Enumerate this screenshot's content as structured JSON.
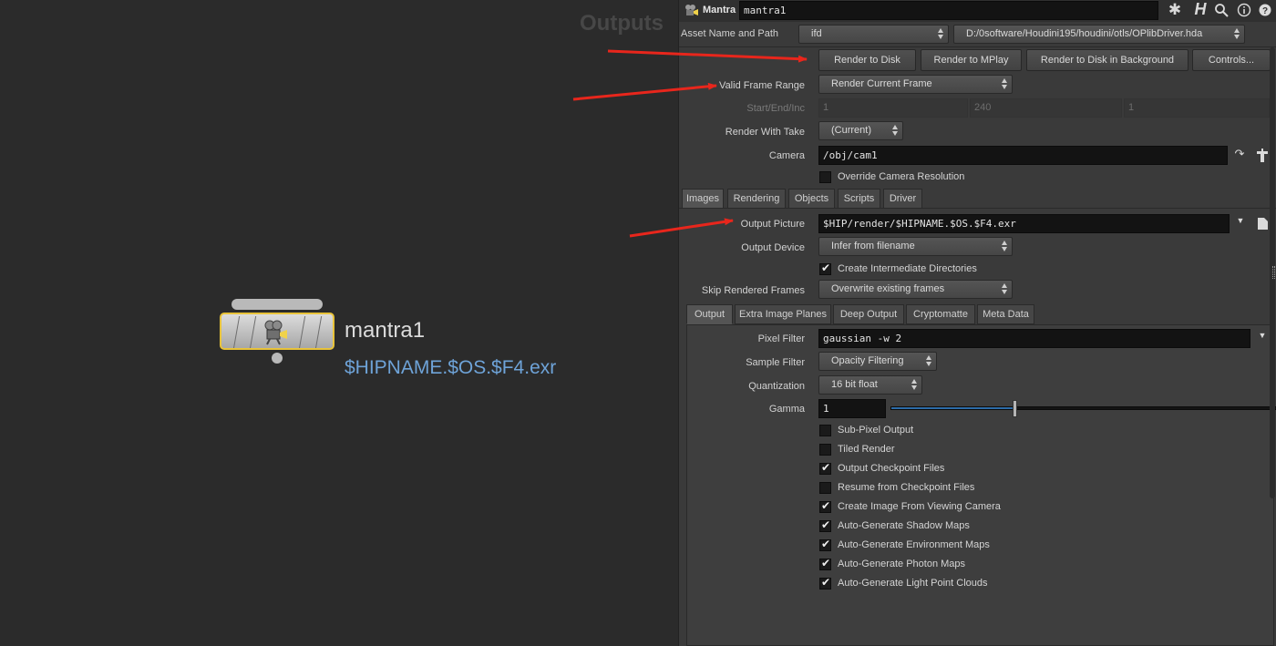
{
  "network": {
    "title": "Outputs",
    "node": {
      "name": "mantra1",
      "output_label": "$HIPNAME.$OS.$F4.exr"
    }
  },
  "header": {
    "type_label": "Mantra",
    "node_name_value": "mantra1",
    "icons": [
      "gear-icon",
      "houdini-help-icon",
      "search-icon",
      "info-icon",
      "help-icon"
    ]
  },
  "asset": {
    "label": "Asset Name and Path",
    "name_value": "ifd",
    "path_value": "D:/0software/Houdini195/houdini/otls/OPlibDriver.hda"
  },
  "render_buttons": [
    "Render to Disk",
    "Render to MPlay",
    "Render to Disk in Background",
    "Controls..."
  ],
  "params": {
    "valid_frame_range": {
      "label": "Valid Frame Range",
      "value": "Render Current Frame"
    },
    "start_end_inc": {
      "label": "Start/End/Inc",
      "values": [
        "1",
        "240",
        "1"
      ]
    },
    "render_with_take": {
      "label": "Render With Take",
      "value": "(Current)"
    },
    "camera": {
      "label": "Camera",
      "value": "/obj/cam1"
    },
    "override_cam_res": {
      "label": "Override Camera Resolution",
      "checked": false
    }
  },
  "main_tabs": [
    "Images",
    "Rendering",
    "Objects",
    "Scripts",
    "Driver"
  ],
  "images": {
    "output_picture": {
      "label": "Output Picture",
      "value": "$HIP/render/$HIPNAME.$OS.$F4.exr"
    },
    "output_device": {
      "label": "Output Device",
      "value": "Infer from filename"
    },
    "create_dirs": {
      "label": "Create Intermediate Directories",
      "checked": true
    },
    "skip_frames": {
      "label": "Skip Rendered Frames",
      "value": "Overwrite existing frames"
    }
  },
  "sub_tabs": [
    "Output",
    "Extra Image Planes",
    "Deep Output",
    "Cryptomatte",
    "Meta Data"
  ],
  "output": {
    "pixel_filter": {
      "label": "Pixel Filter",
      "value": "gaussian -w 2"
    },
    "sample_filter": {
      "label": "Sample Filter",
      "value": "Opacity Filtering"
    },
    "quantization": {
      "label": "Quantization",
      "value": "16 bit float"
    },
    "gamma": {
      "label": "Gamma",
      "value": "1",
      "slider_fraction": 0.32
    },
    "checkboxes": [
      {
        "label": "Sub-Pixel Output",
        "checked": false
      },
      {
        "label": "Tiled Render",
        "checked": false
      },
      {
        "label": "Output Checkpoint Files",
        "checked": true
      },
      {
        "label": "Resume from Checkpoint Files",
        "checked": false
      },
      {
        "label": "Create Image From Viewing Camera",
        "checked": true
      },
      {
        "label": "Auto-Generate Shadow Maps",
        "checked": true
      },
      {
        "label": "Auto-Generate Environment Maps",
        "checked": true
      },
      {
        "label": "Auto-Generate Photon Maps",
        "checked": true
      },
      {
        "label": "Auto-Generate Light Point Clouds",
        "checked": true
      }
    ]
  },
  "colors": {
    "annotation_arrow": "#e8261c",
    "node_highlight": "#e8c33a",
    "node_output_text": "#6ea3d8"
  }
}
